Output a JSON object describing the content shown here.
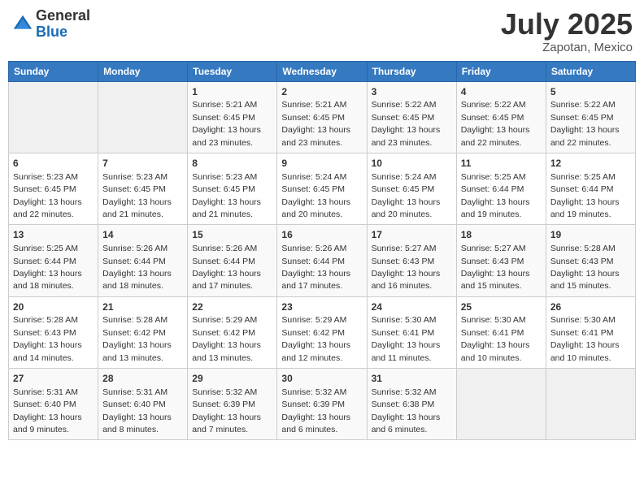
{
  "header": {
    "logo_general": "General",
    "logo_blue": "Blue",
    "month": "July 2025",
    "location": "Zapotan, Mexico"
  },
  "weekdays": [
    "Sunday",
    "Monday",
    "Tuesday",
    "Wednesday",
    "Thursday",
    "Friday",
    "Saturday"
  ],
  "weeks": [
    [
      {
        "day": "",
        "empty": true
      },
      {
        "day": "",
        "empty": true
      },
      {
        "day": "1",
        "sunrise": "5:21 AM",
        "sunset": "6:45 PM",
        "daylight": "13 hours and 23 minutes."
      },
      {
        "day": "2",
        "sunrise": "5:21 AM",
        "sunset": "6:45 PM",
        "daylight": "13 hours and 23 minutes."
      },
      {
        "day": "3",
        "sunrise": "5:22 AM",
        "sunset": "6:45 PM",
        "daylight": "13 hours and 23 minutes."
      },
      {
        "day": "4",
        "sunrise": "5:22 AM",
        "sunset": "6:45 PM",
        "daylight": "13 hours and 22 minutes."
      },
      {
        "day": "5",
        "sunrise": "5:22 AM",
        "sunset": "6:45 PM",
        "daylight": "13 hours and 22 minutes."
      }
    ],
    [
      {
        "day": "6",
        "sunrise": "5:23 AM",
        "sunset": "6:45 PM",
        "daylight": "13 hours and 22 minutes."
      },
      {
        "day": "7",
        "sunrise": "5:23 AM",
        "sunset": "6:45 PM",
        "daylight": "13 hours and 21 minutes."
      },
      {
        "day": "8",
        "sunrise": "5:23 AM",
        "sunset": "6:45 PM",
        "daylight": "13 hours and 21 minutes."
      },
      {
        "day": "9",
        "sunrise": "5:24 AM",
        "sunset": "6:45 PM",
        "daylight": "13 hours and 20 minutes."
      },
      {
        "day": "10",
        "sunrise": "5:24 AM",
        "sunset": "6:45 PM",
        "daylight": "13 hours and 20 minutes."
      },
      {
        "day": "11",
        "sunrise": "5:25 AM",
        "sunset": "6:44 PM",
        "daylight": "13 hours and 19 minutes."
      },
      {
        "day": "12",
        "sunrise": "5:25 AM",
        "sunset": "6:44 PM",
        "daylight": "13 hours and 19 minutes."
      }
    ],
    [
      {
        "day": "13",
        "sunrise": "5:25 AM",
        "sunset": "6:44 PM",
        "daylight": "13 hours and 18 minutes."
      },
      {
        "day": "14",
        "sunrise": "5:26 AM",
        "sunset": "6:44 PM",
        "daylight": "13 hours and 18 minutes."
      },
      {
        "day": "15",
        "sunrise": "5:26 AM",
        "sunset": "6:44 PM",
        "daylight": "13 hours and 17 minutes."
      },
      {
        "day": "16",
        "sunrise": "5:26 AM",
        "sunset": "6:44 PM",
        "daylight": "13 hours and 17 minutes."
      },
      {
        "day": "17",
        "sunrise": "5:27 AM",
        "sunset": "6:43 PM",
        "daylight": "13 hours and 16 minutes."
      },
      {
        "day": "18",
        "sunrise": "5:27 AM",
        "sunset": "6:43 PM",
        "daylight": "13 hours and 15 minutes."
      },
      {
        "day": "19",
        "sunrise": "5:28 AM",
        "sunset": "6:43 PM",
        "daylight": "13 hours and 15 minutes."
      }
    ],
    [
      {
        "day": "20",
        "sunrise": "5:28 AM",
        "sunset": "6:43 PM",
        "daylight": "13 hours and 14 minutes."
      },
      {
        "day": "21",
        "sunrise": "5:28 AM",
        "sunset": "6:42 PM",
        "daylight": "13 hours and 13 minutes."
      },
      {
        "day": "22",
        "sunrise": "5:29 AM",
        "sunset": "6:42 PM",
        "daylight": "13 hours and 13 minutes."
      },
      {
        "day": "23",
        "sunrise": "5:29 AM",
        "sunset": "6:42 PM",
        "daylight": "13 hours and 12 minutes."
      },
      {
        "day": "24",
        "sunrise": "5:30 AM",
        "sunset": "6:41 PM",
        "daylight": "13 hours and 11 minutes."
      },
      {
        "day": "25",
        "sunrise": "5:30 AM",
        "sunset": "6:41 PM",
        "daylight": "13 hours and 10 minutes."
      },
      {
        "day": "26",
        "sunrise": "5:30 AM",
        "sunset": "6:41 PM",
        "daylight": "13 hours and 10 minutes."
      }
    ],
    [
      {
        "day": "27",
        "sunrise": "5:31 AM",
        "sunset": "6:40 PM",
        "daylight": "13 hours and 9 minutes."
      },
      {
        "day": "28",
        "sunrise": "5:31 AM",
        "sunset": "6:40 PM",
        "daylight": "13 hours and 8 minutes."
      },
      {
        "day": "29",
        "sunrise": "5:32 AM",
        "sunset": "6:39 PM",
        "daylight": "13 hours and 7 minutes."
      },
      {
        "day": "30",
        "sunrise": "5:32 AM",
        "sunset": "6:39 PM",
        "daylight": "13 hours and 6 minutes."
      },
      {
        "day": "31",
        "sunrise": "5:32 AM",
        "sunset": "6:38 PM",
        "daylight": "13 hours and 6 minutes."
      },
      {
        "day": "",
        "empty": true
      },
      {
        "day": "",
        "empty": true
      }
    ]
  ]
}
